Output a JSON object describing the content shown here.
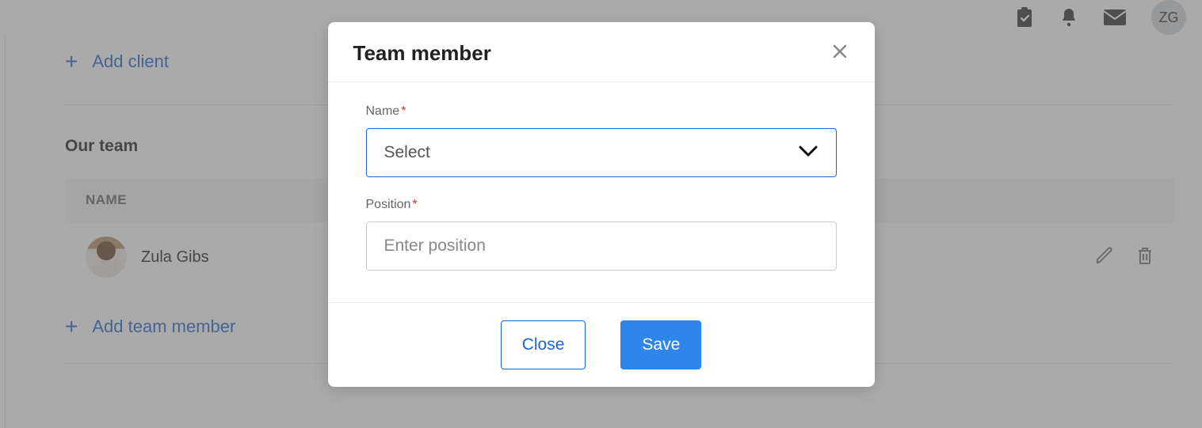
{
  "topbar": {
    "user_initials": "ZG"
  },
  "page": {
    "add_client_label": "Add client",
    "section_heading": "Our team",
    "table": {
      "header_name": "NAME",
      "rows": [
        {
          "name": "Zula Gibs"
        }
      ]
    },
    "add_team_member_label": "Add team member"
  },
  "modal": {
    "title": "Team member",
    "fields": {
      "name": {
        "label": "Name",
        "select_placeholder": "Select"
      },
      "position": {
        "label": "Position",
        "placeholder": "Enter position",
        "value": ""
      }
    },
    "buttons": {
      "close": "Close",
      "save": "Save"
    }
  }
}
